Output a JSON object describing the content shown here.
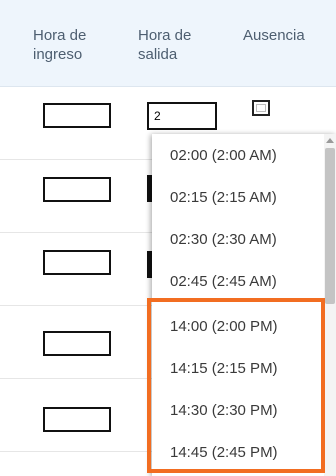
{
  "table": {
    "headers": {
      "entry_time": "Hora de\ningreso",
      "exit_time": "Hora de\nsalida",
      "absence": "Ausencia"
    },
    "active_input": {
      "value": "2"
    }
  },
  "dropdown": {
    "options": [
      "02:00 (2:00 AM)",
      "02:15 (2:15 AM)",
      "02:30 (2:30 AM)",
      "02:45 (2:45 AM)",
      "14:00 (2:00 PM)",
      "14:15 (2:15 PM)",
      "14:30 (2:30 PM)",
      "14:45 (2:45 PM)"
    ]
  },
  "colors": {
    "header_bg": "#eef5fc",
    "header_text": "#4d5e70",
    "highlight": "#f26d21"
  },
  "icons": {
    "scroll_up": "chevron-up-icon"
  }
}
